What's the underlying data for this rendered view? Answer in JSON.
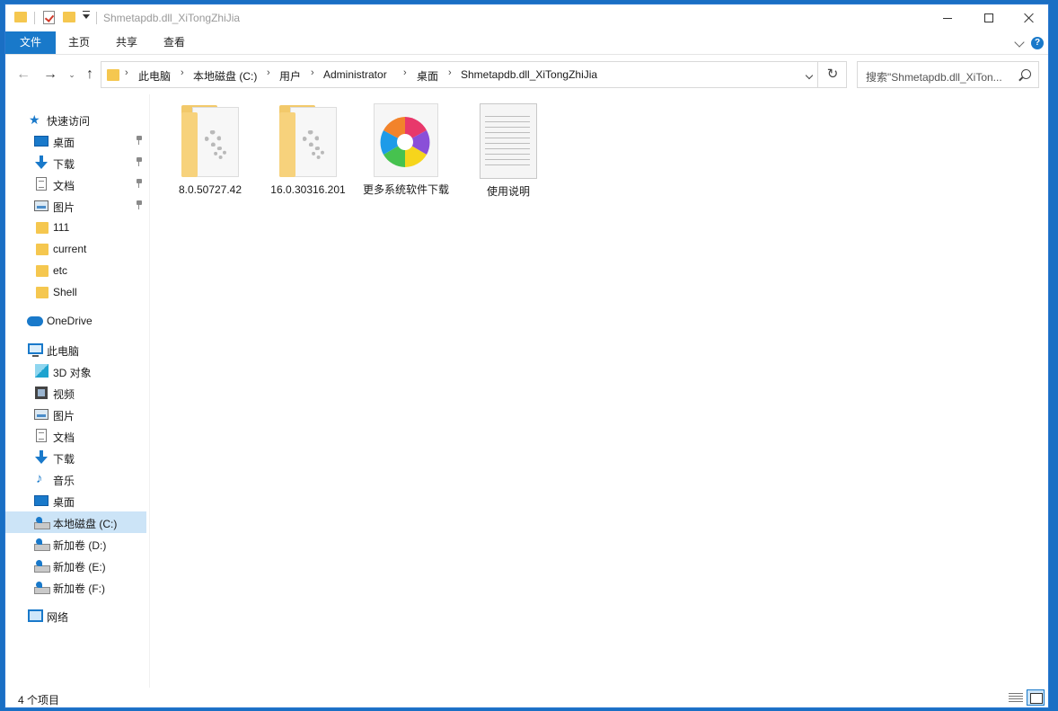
{
  "window": {
    "title": "Shmetapdb.dll_XiTongZhiJia"
  },
  "ribbon": {
    "tabs": [
      {
        "label": "文件"
      },
      {
        "label": "主页"
      },
      {
        "label": "共享"
      },
      {
        "label": "查看"
      }
    ],
    "help_label": "?"
  },
  "address": {
    "crumbs": [
      "此电脑",
      "本地磁盘 (C:)",
      "用户",
      "Administrator",
      "桌面",
      "Shmetapdb.dll_XiTongZhiJia"
    ]
  },
  "search": {
    "placeholder": "搜索\"Shmetapdb.dll_XiTon..."
  },
  "sidebar": {
    "quick_access": "快速访问",
    "quick_items": [
      {
        "label": "桌面",
        "icon": "desktop-icon",
        "pinned": true
      },
      {
        "label": "下载",
        "icon": "download-icon",
        "pinned": true
      },
      {
        "label": "文档",
        "icon": "document-icon",
        "pinned": true
      },
      {
        "label": "图片",
        "icon": "picture-icon",
        "pinned": true
      },
      {
        "label": "111",
        "icon": "folder-icon",
        "pinned": false
      },
      {
        "label": "current",
        "icon": "folder-icon",
        "pinned": false
      },
      {
        "label": "etc",
        "icon": "folder-icon",
        "pinned": false
      },
      {
        "label": "Shell",
        "icon": "folder-icon",
        "pinned": false
      }
    ],
    "onedrive": "OneDrive",
    "this_pc": "此电脑",
    "pc_items": [
      {
        "label": "3D 对象",
        "icon": "3d-objects-icon"
      },
      {
        "label": "视频",
        "icon": "video-icon"
      },
      {
        "label": "图片",
        "icon": "picture-icon"
      },
      {
        "label": "文档",
        "icon": "document-icon"
      },
      {
        "label": "下载",
        "icon": "download-icon"
      },
      {
        "label": "音乐",
        "icon": "music-icon"
      },
      {
        "label": "桌面",
        "icon": "desktop-icon"
      },
      {
        "label": "本地磁盘 (C:)",
        "icon": "drive-icon",
        "selected": true
      },
      {
        "label": "新加卷 (D:)",
        "icon": "drive-icon"
      },
      {
        "label": "新加卷 (E:)",
        "icon": "drive-icon"
      },
      {
        "label": "新加卷 (F:)",
        "icon": "drive-icon"
      }
    ],
    "network": "网络"
  },
  "files": [
    {
      "name": "8.0.50727.42",
      "icon": "folder-gear-icon"
    },
    {
      "name": "16.0.30316.201",
      "icon": "folder-gear-icon"
    },
    {
      "name": "更多系统软件下载",
      "icon": "pinwheel-icon"
    },
    {
      "name": "使用说明",
      "icon": "text-document-icon"
    }
  ],
  "status": {
    "item_count": "4 个项目"
  },
  "colors": {
    "accent": "#1979ca",
    "selection": "#cce4f7",
    "folder": "#f5c74f"
  }
}
